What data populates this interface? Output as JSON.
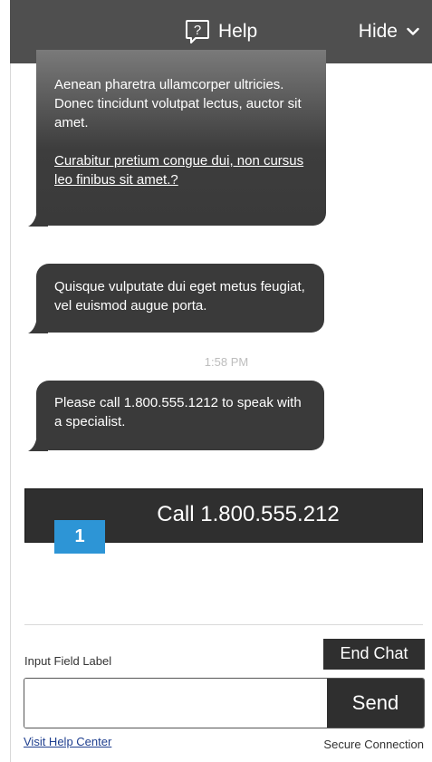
{
  "header": {
    "help_label": "Help",
    "help_icon_glyph": "?",
    "hide_label": "Hide",
    "background": "#4f4f4f"
  },
  "messages": [
    {
      "lines": "Aenean pharetra ullamcorper ultricies. Donec tincidunt volutpat lectus, auctor sit amet.",
      "link": "Curabitur pretium congue dui, non cursus leo finibus sit amet.?"
    },
    {
      "text": "Quisque vulputate dui eget metus feugiat, vel euismod augue porta."
    },
    {
      "text": "Please call 1.800.555.1212 to speak with a specialist."
    }
  ],
  "timestamp": "1:58 PM",
  "call_button": {
    "label": "Call 1.800.555.212",
    "badge": "1",
    "badge_color": "#2d95d6"
  },
  "composer": {
    "label": "Input Field Label",
    "end_chat_label": "End Chat",
    "input_value": "",
    "send_label": "Send"
  },
  "footer": {
    "visit_help_center": "Visit Help Center",
    "secure_connection": "Secure Connection"
  }
}
